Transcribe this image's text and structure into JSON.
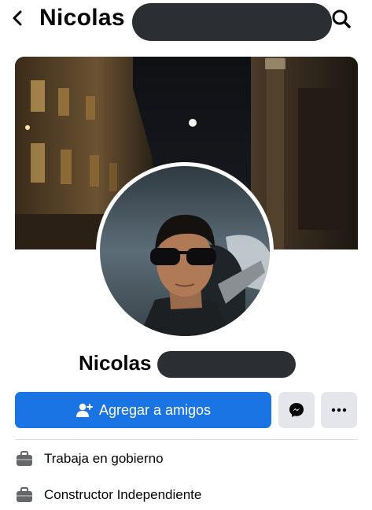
{
  "header": {
    "title": "Nicolas",
    "back_icon": "chevron-left-icon",
    "search_icon": "search-icon"
  },
  "profile": {
    "name": "Nicolas"
  },
  "actions": {
    "add_friend_label": "Agregar a amigos",
    "add_friend_icon": "add-person-icon",
    "messenger_icon": "messenger-icon",
    "more_icon": "more-dots-icon"
  },
  "info": [
    {
      "icon": "briefcase-icon",
      "text": "Trabaja en gobierno"
    },
    {
      "icon": "briefcase-icon",
      "text": "Constructor Independiente"
    }
  ],
  "colors": {
    "primary_button": "#1b74e4",
    "secondary_button": "#e4e6eb",
    "redaction": "#2b2f33"
  }
}
